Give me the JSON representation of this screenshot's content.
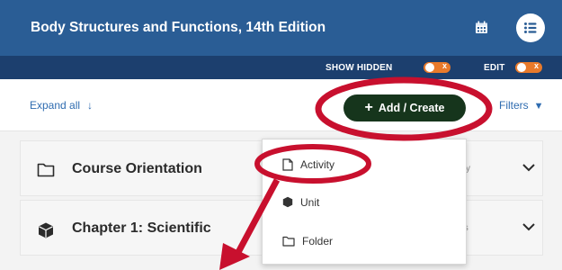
{
  "header": {
    "title": "Body Structures and Functions, 14th Edition"
  },
  "toggles": {
    "show_hidden_label": "SHOW HIDDEN",
    "edit_label": "EDIT",
    "off_glyph": "x"
  },
  "toolbar": {
    "expand_all_label": "Expand all",
    "expand_all_arrow": "↓",
    "add_create_plus": "+",
    "add_create_label": "Add / Create",
    "filters_label": "Filters",
    "filters_icon": "▼"
  },
  "rows": [
    {
      "title": "Course Orientation",
      "meta": "vity"
    },
    {
      "title": "Chapter 1: Scientific",
      "meta": "ies"
    }
  ],
  "dropdown": {
    "items": [
      {
        "label": "Activity",
        "icon": "document-icon"
      },
      {
        "label": "Unit",
        "icon": "cube-icon"
      },
      {
        "label": "Folder",
        "icon": "folder-icon"
      }
    ]
  },
  "colors": {
    "header_bg": "#2a5d95",
    "toggle_bar_bg": "#1c3f6e",
    "add_button_bg": "#16351c",
    "toggle_on": "#e97a2b",
    "link": "#2f6cb0",
    "annotation_red": "#c8102e"
  }
}
